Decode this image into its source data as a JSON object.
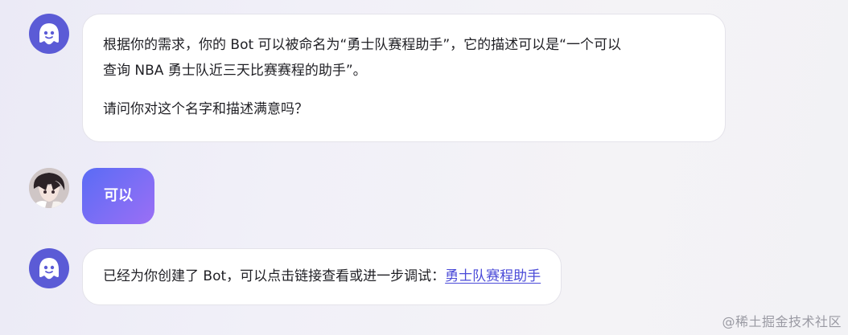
{
  "messages": [
    {
      "role": "bot",
      "avatar_icon": "ghost-bot-icon",
      "line1": "根据你的需求，你的 Bot 可以被命名为“勇士队赛程助手”，它的描述可以是“一个可以",
      "line2": "查询 NBA 勇士队近三天比赛赛程的助手”。",
      "line3": "请问你对这个名字和描述满意吗？"
    },
    {
      "role": "user",
      "avatar_icon": "anime-user-avatar",
      "text": "可以"
    },
    {
      "role": "bot",
      "avatar_icon": "ghost-bot-icon",
      "text": "已经为你创建了 Bot，可以点击链接查看或进一步调试：",
      "link_text": "勇士队赛程助手"
    }
  ],
  "watermark": "@稀土掘金技术社区",
  "colors": {
    "bot_avatar": "#5b5bd6",
    "user_bubble_start": "#5a6cf5",
    "user_bubble_end": "#9b6ff5",
    "link": "#4a4ad8"
  }
}
